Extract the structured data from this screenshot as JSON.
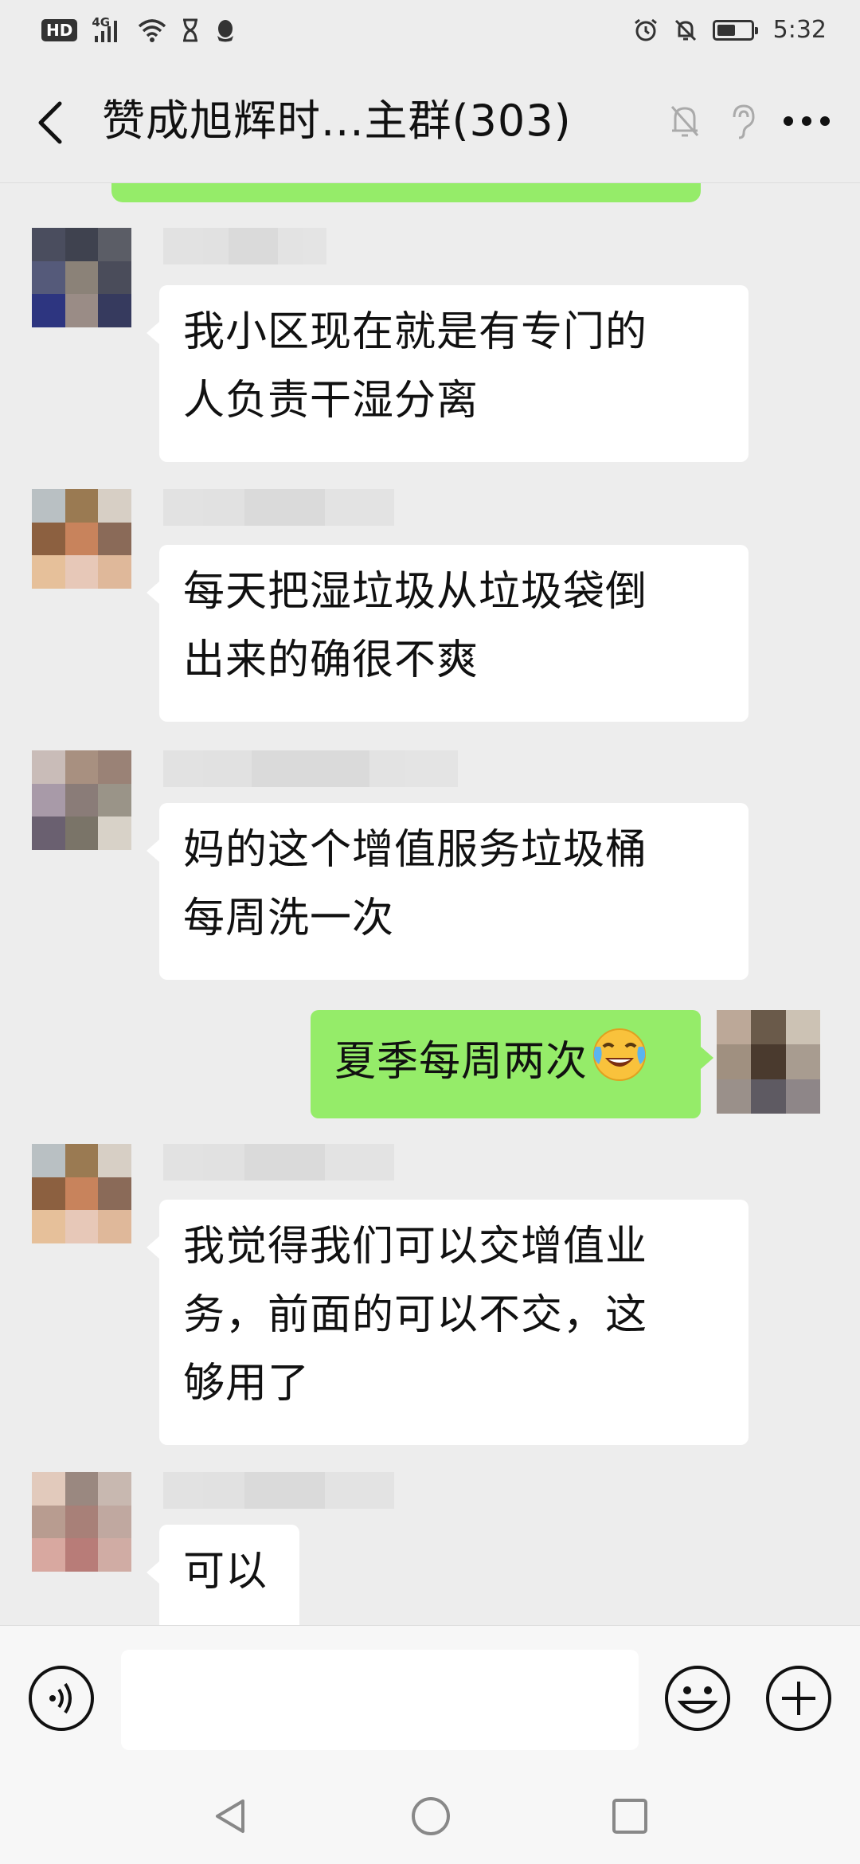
{
  "status_bar": {
    "hd": "HD",
    "network": "4G",
    "time": "5:32",
    "battery_level": 0.55,
    "icons": [
      "signal-icon",
      "wifi-icon",
      "hourglass-icon",
      "qq-penguin-icon",
      "alarm-icon",
      "mute-bell-icon",
      "battery-icon"
    ]
  },
  "header": {
    "title": "赞成旭辉时...主群(303)",
    "icons": [
      "back-icon",
      "mute-bell-icon",
      "earpiece-icon",
      "more-icon"
    ]
  },
  "messages": [
    {
      "side": "left",
      "lines": [
        "我小区现在就是有专门的",
        "人负责干湿分离"
      ]
    },
    {
      "side": "left",
      "lines": [
        "每天把湿垃圾从垃圾袋倒",
        "出来的确很不爽"
      ]
    },
    {
      "side": "left",
      "lines": [
        "妈的这个增值服务垃圾桶",
        "每周洗一次"
      ]
    },
    {
      "side": "right",
      "lines": [
        "夏季每周两次"
      ],
      "emoji": "crying-laughing-emoji"
    },
    {
      "side": "left",
      "lines": [
        "我觉得我们可以交增值业",
        "务，前面的可以不交，这",
        "够用了"
      ]
    },
    {
      "side": "left",
      "lines": [
        "可以"
      ]
    }
  ],
  "input_bar": {
    "placeholder": "",
    "icons": [
      "voice-icon",
      "emoji-icon",
      "plus-icon"
    ]
  },
  "nav_bar": {
    "icons": [
      "nav-back-icon",
      "nav-home-icon",
      "nav-recents-icon"
    ]
  },
  "colors": {
    "background": "#ededed",
    "own_bubble": "#95ec69",
    "other_bubble": "#ffffff",
    "input_bar": "#f7f7f7"
  }
}
